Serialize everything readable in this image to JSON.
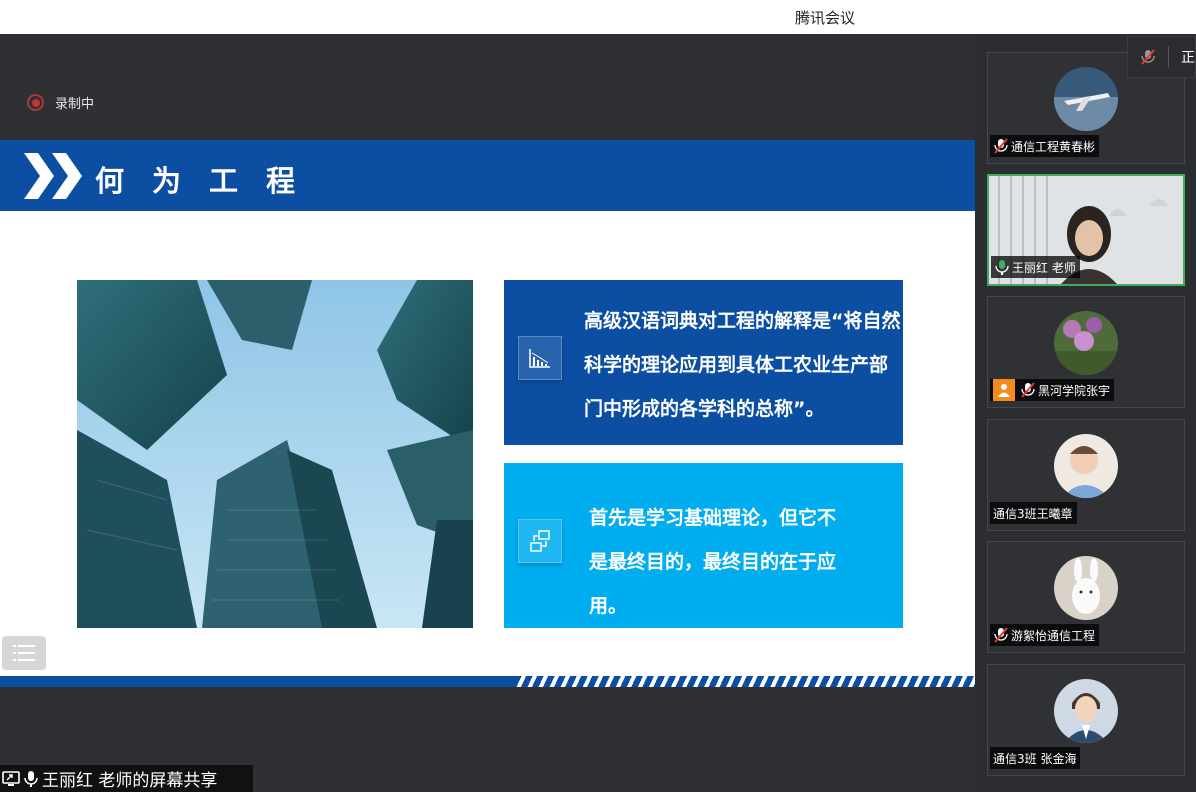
{
  "window": {
    "title": "腾讯会议"
  },
  "recording": {
    "label": "录制中"
  },
  "slide": {
    "title": "何为工程",
    "box1_text": "高级汉语词典对工程的解释是“将自然科学的理论应用到具体工农业生产部门中形成的各学科的总称”。",
    "box2_text": "首先是学习基础理论，但它不是最终目的，最终目的在于应用。"
  },
  "share": {
    "label": "王丽红 老师的屏幕共享"
  },
  "top_control": {
    "label": "正"
  },
  "participants": [
    {
      "name": "通信工程黄春彬",
      "muted": true,
      "avatar": "airplane"
    },
    {
      "name": "王丽红 老师",
      "muted": false,
      "speaking": true,
      "avatar": "video"
    },
    {
      "name": "黑河学院张宇",
      "muted": true,
      "avatar": "flowers",
      "badge": "person-icon"
    },
    {
      "name": "通信3班王曦章",
      "muted": null,
      "avatar": "baby"
    },
    {
      "name": "游絮怡通信工程",
      "muted": true,
      "avatar": "plush-bunny"
    },
    {
      "name": "通信3班 张金海",
      "muted": null,
      "avatar": "cartoon-man"
    }
  ],
  "colors": {
    "brand_blue": "#0b4ea2",
    "light_blue": "#00adef",
    "active_green": "#3fae5e"
  }
}
